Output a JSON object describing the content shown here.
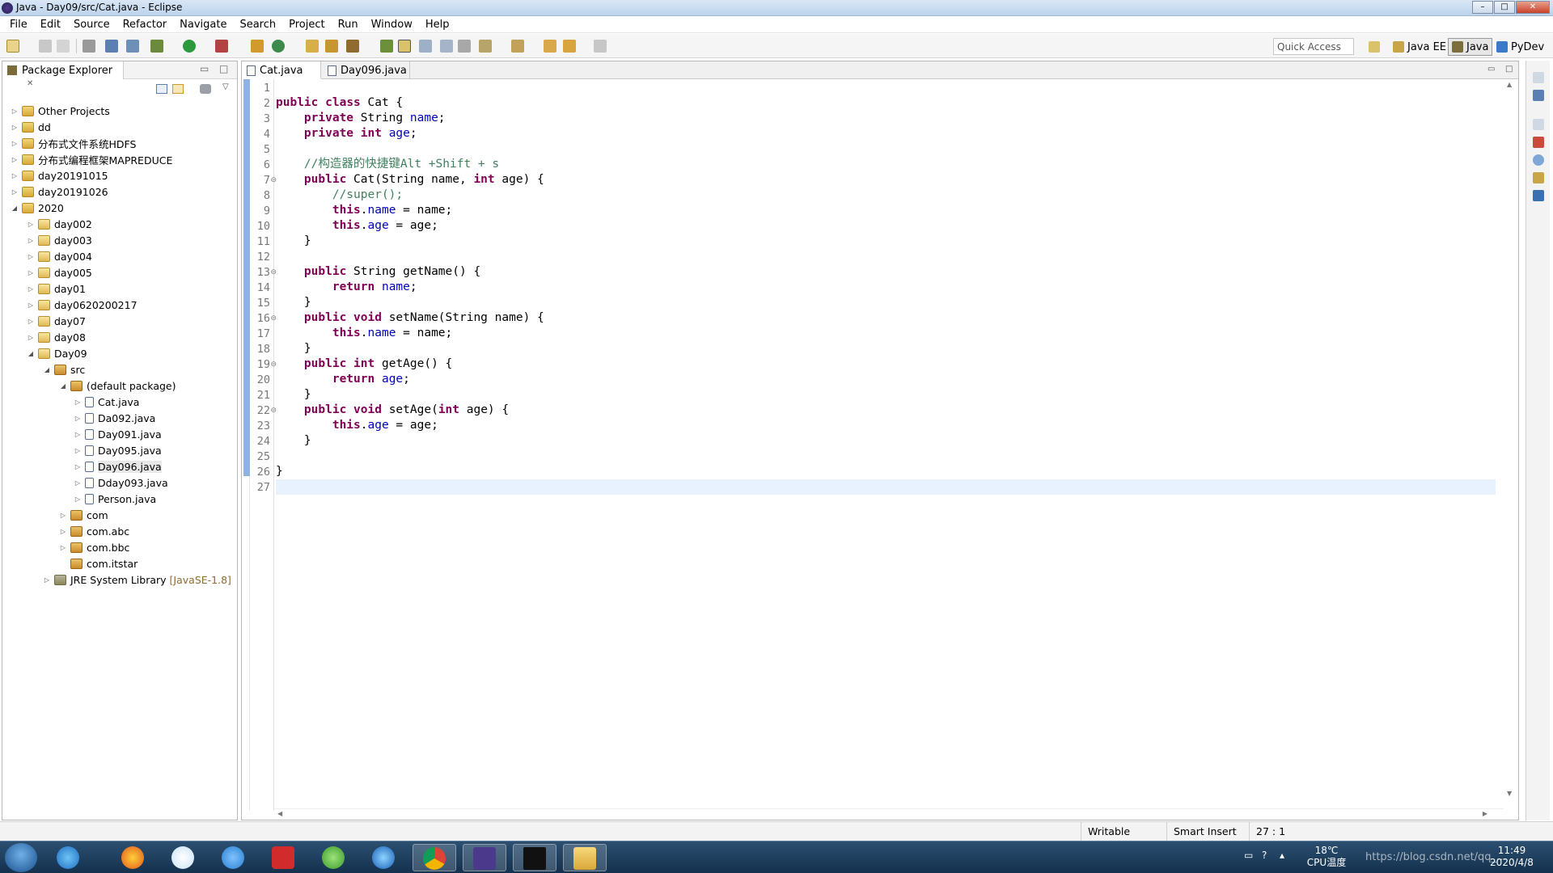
{
  "window": {
    "title": "Java - Day09/src/Cat.java - Eclipse"
  },
  "menu": [
    "File",
    "Edit",
    "Source",
    "Refactor",
    "Navigate",
    "Search",
    "Project",
    "Run",
    "Window",
    "Help"
  ],
  "quick_access": {
    "placeholder": "Quick Access"
  },
  "perspectives": [
    "Java EE",
    "Java",
    "PyDev"
  ],
  "explorer": {
    "title": "Package Explorer",
    "nodes": [
      {
        "label": "Other Projects",
        "icon": "project-folder-icon"
      },
      {
        "label": "dd",
        "icon": "project-folder-icon"
      },
      {
        "label": "分布式文件系统HDFS",
        "icon": "project-folder-icon"
      },
      {
        "label": "分布式编程框架MAPREDUCE",
        "icon": "project-folder-icon"
      },
      {
        "label": "day20191015",
        "icon": "project-folder-icon"
      },
      {
        "label": "day20191026",
        "icon": "project-folder-icon"
      },
      {
        "label": "2020",
        "icon": "project-folder-icon"
      },
      {
        "label": "day002",
        "icon": "java-project-icon"
      },
      {
        "label": "day003",
        "icon": "java-project-icon"
      },
      {
        "label": "day004",
        "icon": "java-project-icon"
      },
      {
        "label": "day005",
        "icon": "java-project-icon"
      },
      {
        "label": "day01",
        "icon": "java-project-icon"
      },
      {
        "label": "day0620200217",
        "icon": "java-project-icon"
      },
      {
        "label": "day07",
        "icon": "java-project-icon"
      },
      {
        "label": "day08",
        "icon": "java-project-icon"
      },
      {
        "label": "Day09",
        "icon": "java-project-icon"
      },
      {
        "label": "src",
        "icon": "source-folder-icon"
      },
      {
        "label": "(default package)",
        "icon": "package-icon"
      },
      {
        "label": "Cat.java",
        "icon": "java-file-icon"
      },
      {
        "label": "Da092.java",
        "icon": "java-file-icon"
      },
      {
        "label": "Day091.java",
        "icon": "java-file-icon"
      },
      {
        "label": "Day095.java",
        "icon": "java-file-icon"
      },
      {
        "label": "Day096.java",
        "icon": "java-file-icon"
      },
      {
        "label": "Dday093.java",
        "icon": "java-file-icon"
      },
      {
        "label": "Person.java",
        "icon": "java-file-icon"
      },
      {
        "label": "com",
        "icon": "package-icon"
      },
      {
        "label": "com.abc",
        "icon": "package-icon"
      },
      {
        "label": "com.bbc",
        "icon": "package-icon"
      },
      {
        "label": "com.itstar",
        "icon": "package-icon"
      },
      {
        "label": "JRE System Library",
        "suffix": "[JavaSE-1.8]",
        "icon": "library-icon"
      }
    ]
  },
  "editor": {
    "tabs": [
      "Cat.java",
      "Day096.java"
    ],
    "line_numbers": [
      "1",
      "2",
      "3",
      "4",
      "5",
      "6",
      "7",
      "8",
      "9",
      "10",
      "11",
      "12",
      "13",
      "14",
      "15",
      "16",
      "17",
      "18",
      "19",
      "20",
      "21",
      "22",
      "23",
      "24",
      "25",
      "26",
      "27"
    ],
    "lines": [
      "",
      "public class Cat {",
      "    private String name;",
      "    private int age;",
      "",
      "    //构造器的快捷键Alt +Shift + s",
      "    public Cat(String name, int age) {",
      "        //super();",
      "        this.name = name;",
      "        this.age = age;",
      "    }",
      "",
      "    public String getName() {",
      "        return name;",
      "    }",
      "    public void setName(String name) {",
      "        this.name = name;",
      "    }",
      "    public int getAge() {",
      "        return age;",
      "    }",
      "    public void setAge(int age) {",
      "        this.age = age;",
      "    }",
      "",
      "}",
      ""
    ]
  },
  "status": {
    "writable": "Writable",
    "insert_mode": "Smart Insert",
    "position": "27 : 1"
  },
  "taskbar": {
    "temperature": "18℃",
    "cpu_label": "CPU温度",
    "time": "11:49",
    "date": "2020/4/8",
    "watermark": "https://blog.csdn.net/qq_..."
  }
}
